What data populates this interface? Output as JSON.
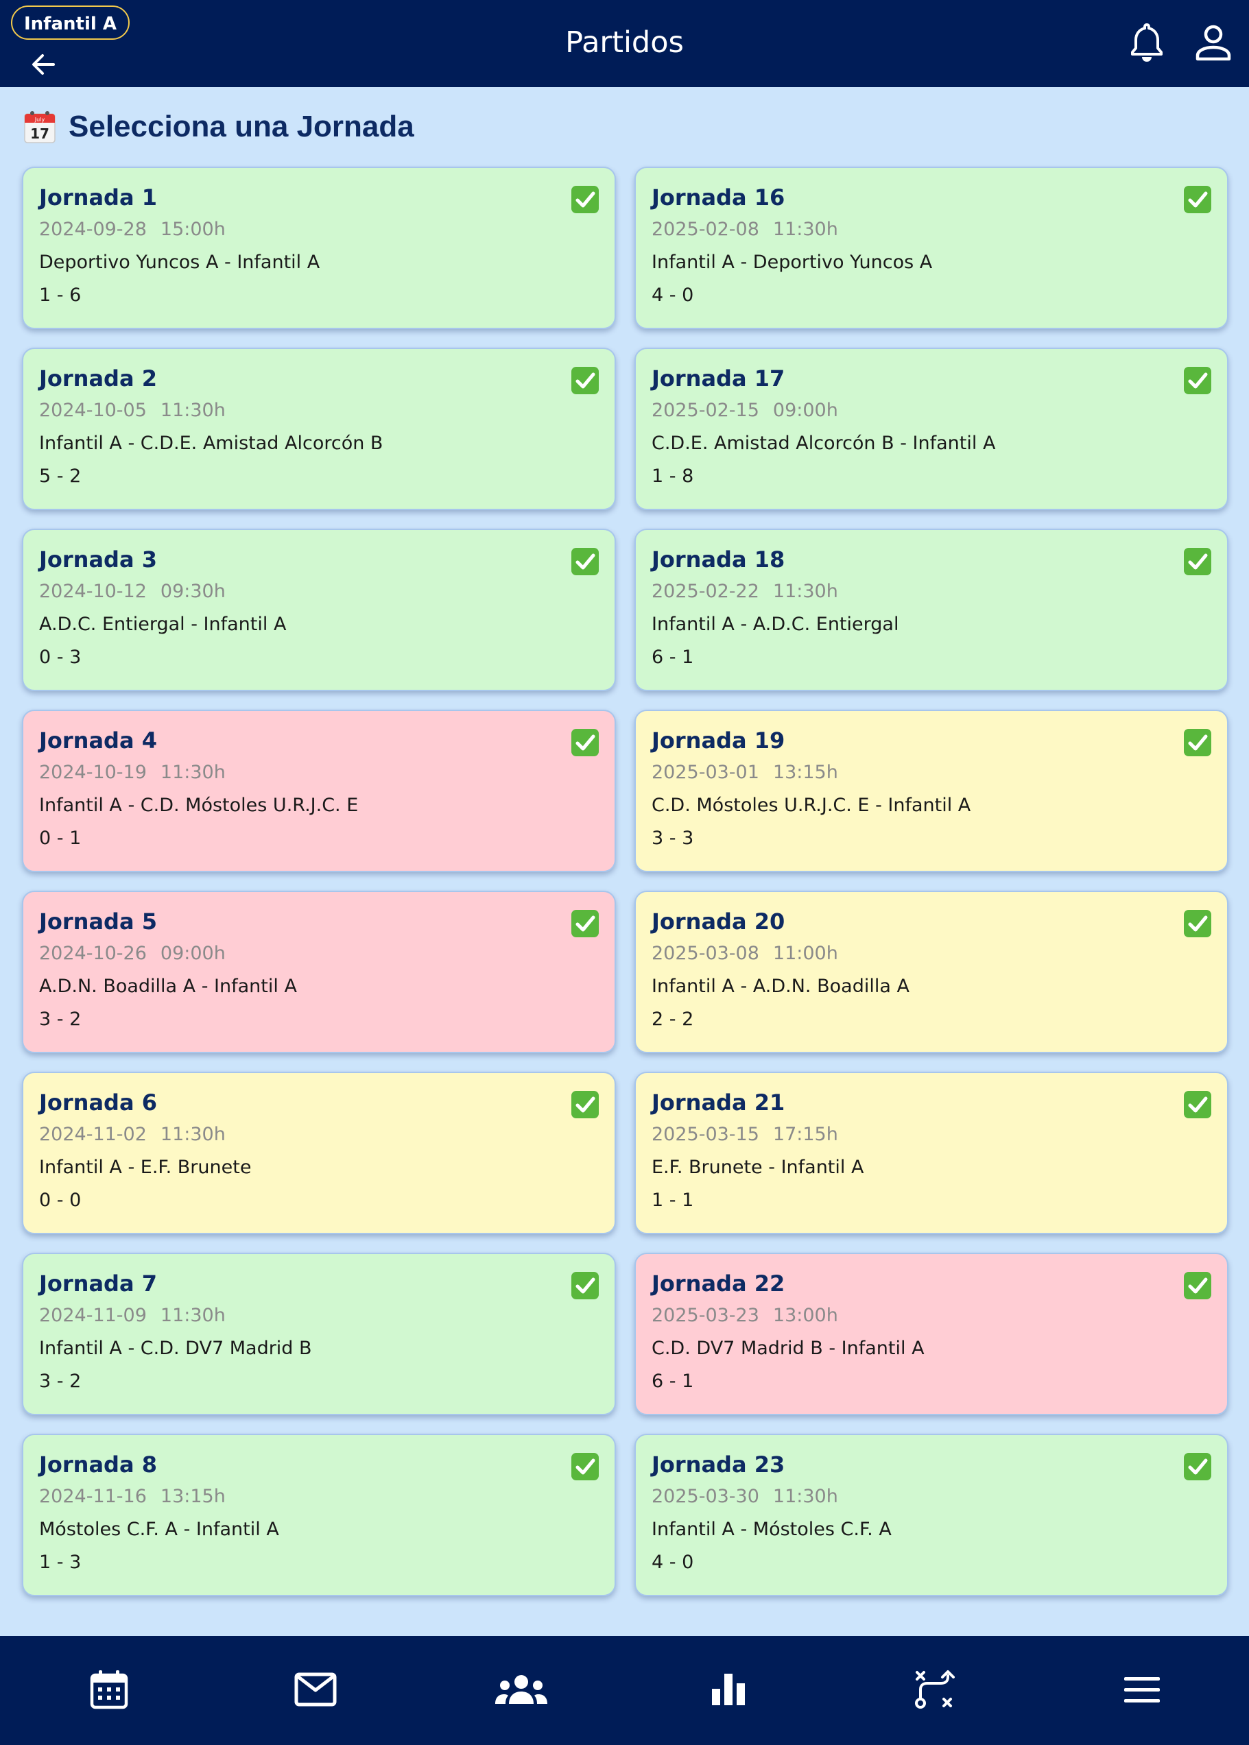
{
  "header": {
    "team_badge": "Infantil A",
    "title": "Partidos",
    "icons": {
      "back": "arrow-left-icon",
      "notifications": "bell-icon",
      "profile": "user-icon"
    }
  },
  "section": {
    "icon": "calendar-emoji-icon",
    "title": "Selecciona una Jornada"
  },
  "colors": {
    "win": "#d1f8d0",
    "loss": "#ffcdd4",
    "draw": "#fef9c5",
    "header_bg": "#001c57",
    "page_bg": "#cce4fb",
    "check": "#59b73c"
  },
  "jornadas": [
    {
      "title": "Jornada 1",
      "date": "2024-09-28",
      "time": "15:00h",
      "match": "Deportivo Yuncos A - Infantil A",
      "score": "1 - 6",
      "result": "win",
      "played": true
    },
    {
      "title": "Jornada 16",
      "date": "2025-02-08",
      "time": "11:30h",
      "match": "Infantil A - Deportivo Yuncos A",
      "score": "4 - 0",
      "result": "win",
      "played": true
    },
    {
      "title": "Jornada 2",
      "date": "2024-10-05",
      "time": "11:30h",
      "match": "Infantil A - C.D.E. Amistad Alcorcón B",
      "score": "5 - 2",
      "result": "win",
      "played": true
    },
    {
      "title": "Jornada 17",
      "date": "2025-02-15",
      "time": "09:00h",
      "match": "C.D.E. Amistad Alcorcón B - Infantil A",
      "score": "1 - 8",
      "result": "win",
      "played": true
    },
    {
      "title": "Jornada 3",
      "date": "2024-10-12",
      "time": "09:30h",
      "match": "A.D.C. Entiergal - Infantil A",
      "score": "0 - 3",
      "result": "win",
      "played": true
    },
    {
      "title": "Jornada 18",
      "date": "2025-02-22",
      "time": "11:30h",
      "match": "Infantil A - A.D.C. Entiergal",
      "score": "6 - 1",
      "result": "win",
      "played": true
    },
    {
      "title": "Jornada 4",
      "date": "2024-10-19",
      "time": "11:30h",
      "match": "Infantil A - C.D. Móstoles U.R.J.C. E",
      "score": "0 - 1",
      "result": "loss",
      "played": true
    },
    {
      "title": "Jornada 19",
      "date": "2025-03-01",
      "time": "13:15h",
      "match": "C.D. Móstoles U.R.J.C. E - Infantil A",
      "score": "3 - 3",
      "result": "draw",
      "played": true
    },
    {
      "title": "Jornada 5",
      "date": "2024-10-26",
      "time": "09:00h",
      "match": "A.D.N. Boadilla A - Infantil A",
      "score": "3 - 2",
      "result": "loss",
      "played": true
    },
    {
      "title": "Jornada 20",
      "date": "2025-03-08",
      "time": "11:00h",
      "match": "Infantil A - A.D.N. Boadilla A",
      "score": "2 - 2",
      "result": "draw",
      "played": true
    },
    {
      "title": "Jornada 6",
      "date": "2024-11-02",
      "time": "11:30h",
      "match": "Infantil A - E.F. Brunete",
      "score": "0 - 0",
      "result": "draw",
      "played": true
    },
    {
      "title": "Jornada 21",
      "date": "2025-03-15",
      "time": "17:15h",
      "match": "E.F. Brunete - Infantil A",
      "score": "1 - 1",
      "result": "draw",
      "played": true
    },
    {
      "title": "Jornada 7",
      "date": "2024-11-09",
      "time": "11:30h",
      "match": "Infantil A - C.D. DV7 Madrid B",
      "score": "3 - 2",
      "result": "win",
      "played": true
    },
    {
      "title": "Jornada 22",
      "date": "2025-03-23",
      "time": "13:00h",
      "match": "C.D. DV7 Madrid B - Infantil A",
      "score": "6 - 1",
      "result": "loss",
      "played": true
    },
    {
      "title": "Jornada 8",
      "date": "2024-11-16",
      "time": "13:15h",
      "match": "Móstoles C.F. A - Infantil A",
      "score": "1 - 3",
      "result": "win",
      "played": true
    },
    {
      "title": "Jornada 23",
      "date": "2025-03-30",
      "time": "11:30h",
      "match": "Infantil A - Móstoles C.F. A",
      "score": "4 - 0",
      "result": "win",
      "played": true
    }
  ],
  "bottom_nav": [
    {
      "icon": "calendar-icon"
    },
    {
      "icon": "mail-icon"
    },
    {
      "icon": "team-icon"
    },
    {
      "icon": "stats-icon"
    },
    {
      "icon": "tactics-icon"
    },
    {
      "icon": "menu-icon"
    }
  ]
}
